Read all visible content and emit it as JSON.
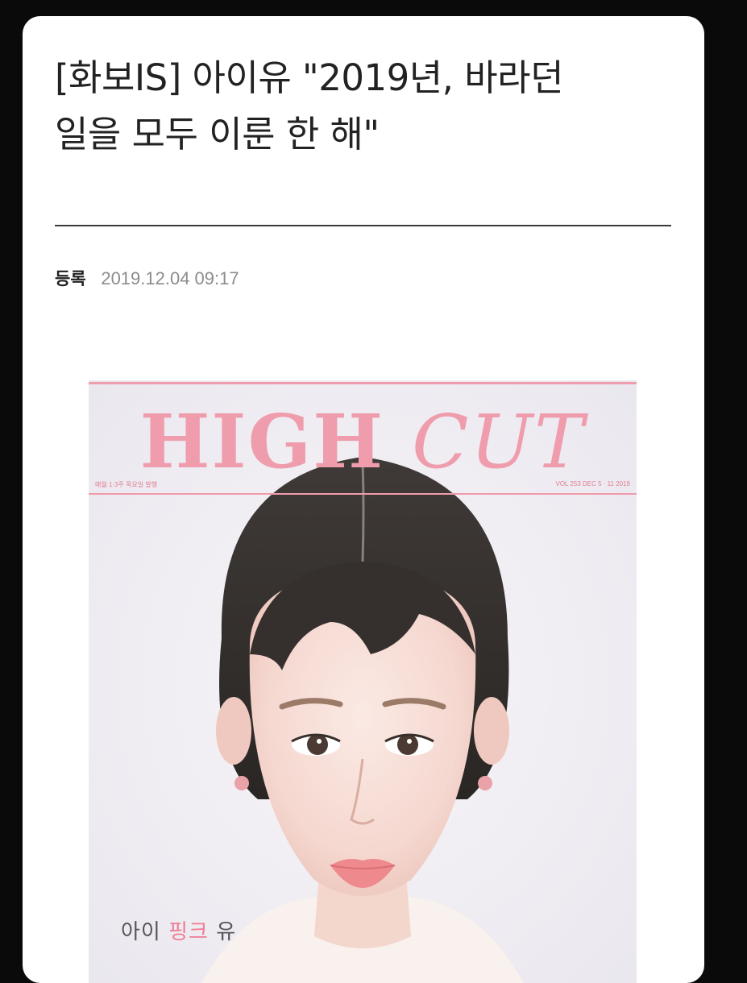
{
  "article": {
    "headline": "[화보IS] 아이유 \"2019년, 바라던\n일을 모두 이룬 한 해\"",
    "meta_label": "등록",
    "date": "2019.12.04 09:17"
  },
  "cover": {
    "title_part1": "HIGH ",
    "title_part2": "CUT",
    "issue_left": "매월 1·3주 목요일 발행",
    "issue_right": "VOL 253 DEC 5 · 11 2019",
    "coverline_part1": "아이 ",
    "coverline_pink": "핑크",
    "coverline_part2": " 유"
  },
  "colors": {
    "page_background": "#0a0a0a",
    "card_background": "#ffffff",
    "headline_text": "#222222",
    "date_text": "#8c8c8c",
    "magazine_pink": "#ef9cac"
  }
}
